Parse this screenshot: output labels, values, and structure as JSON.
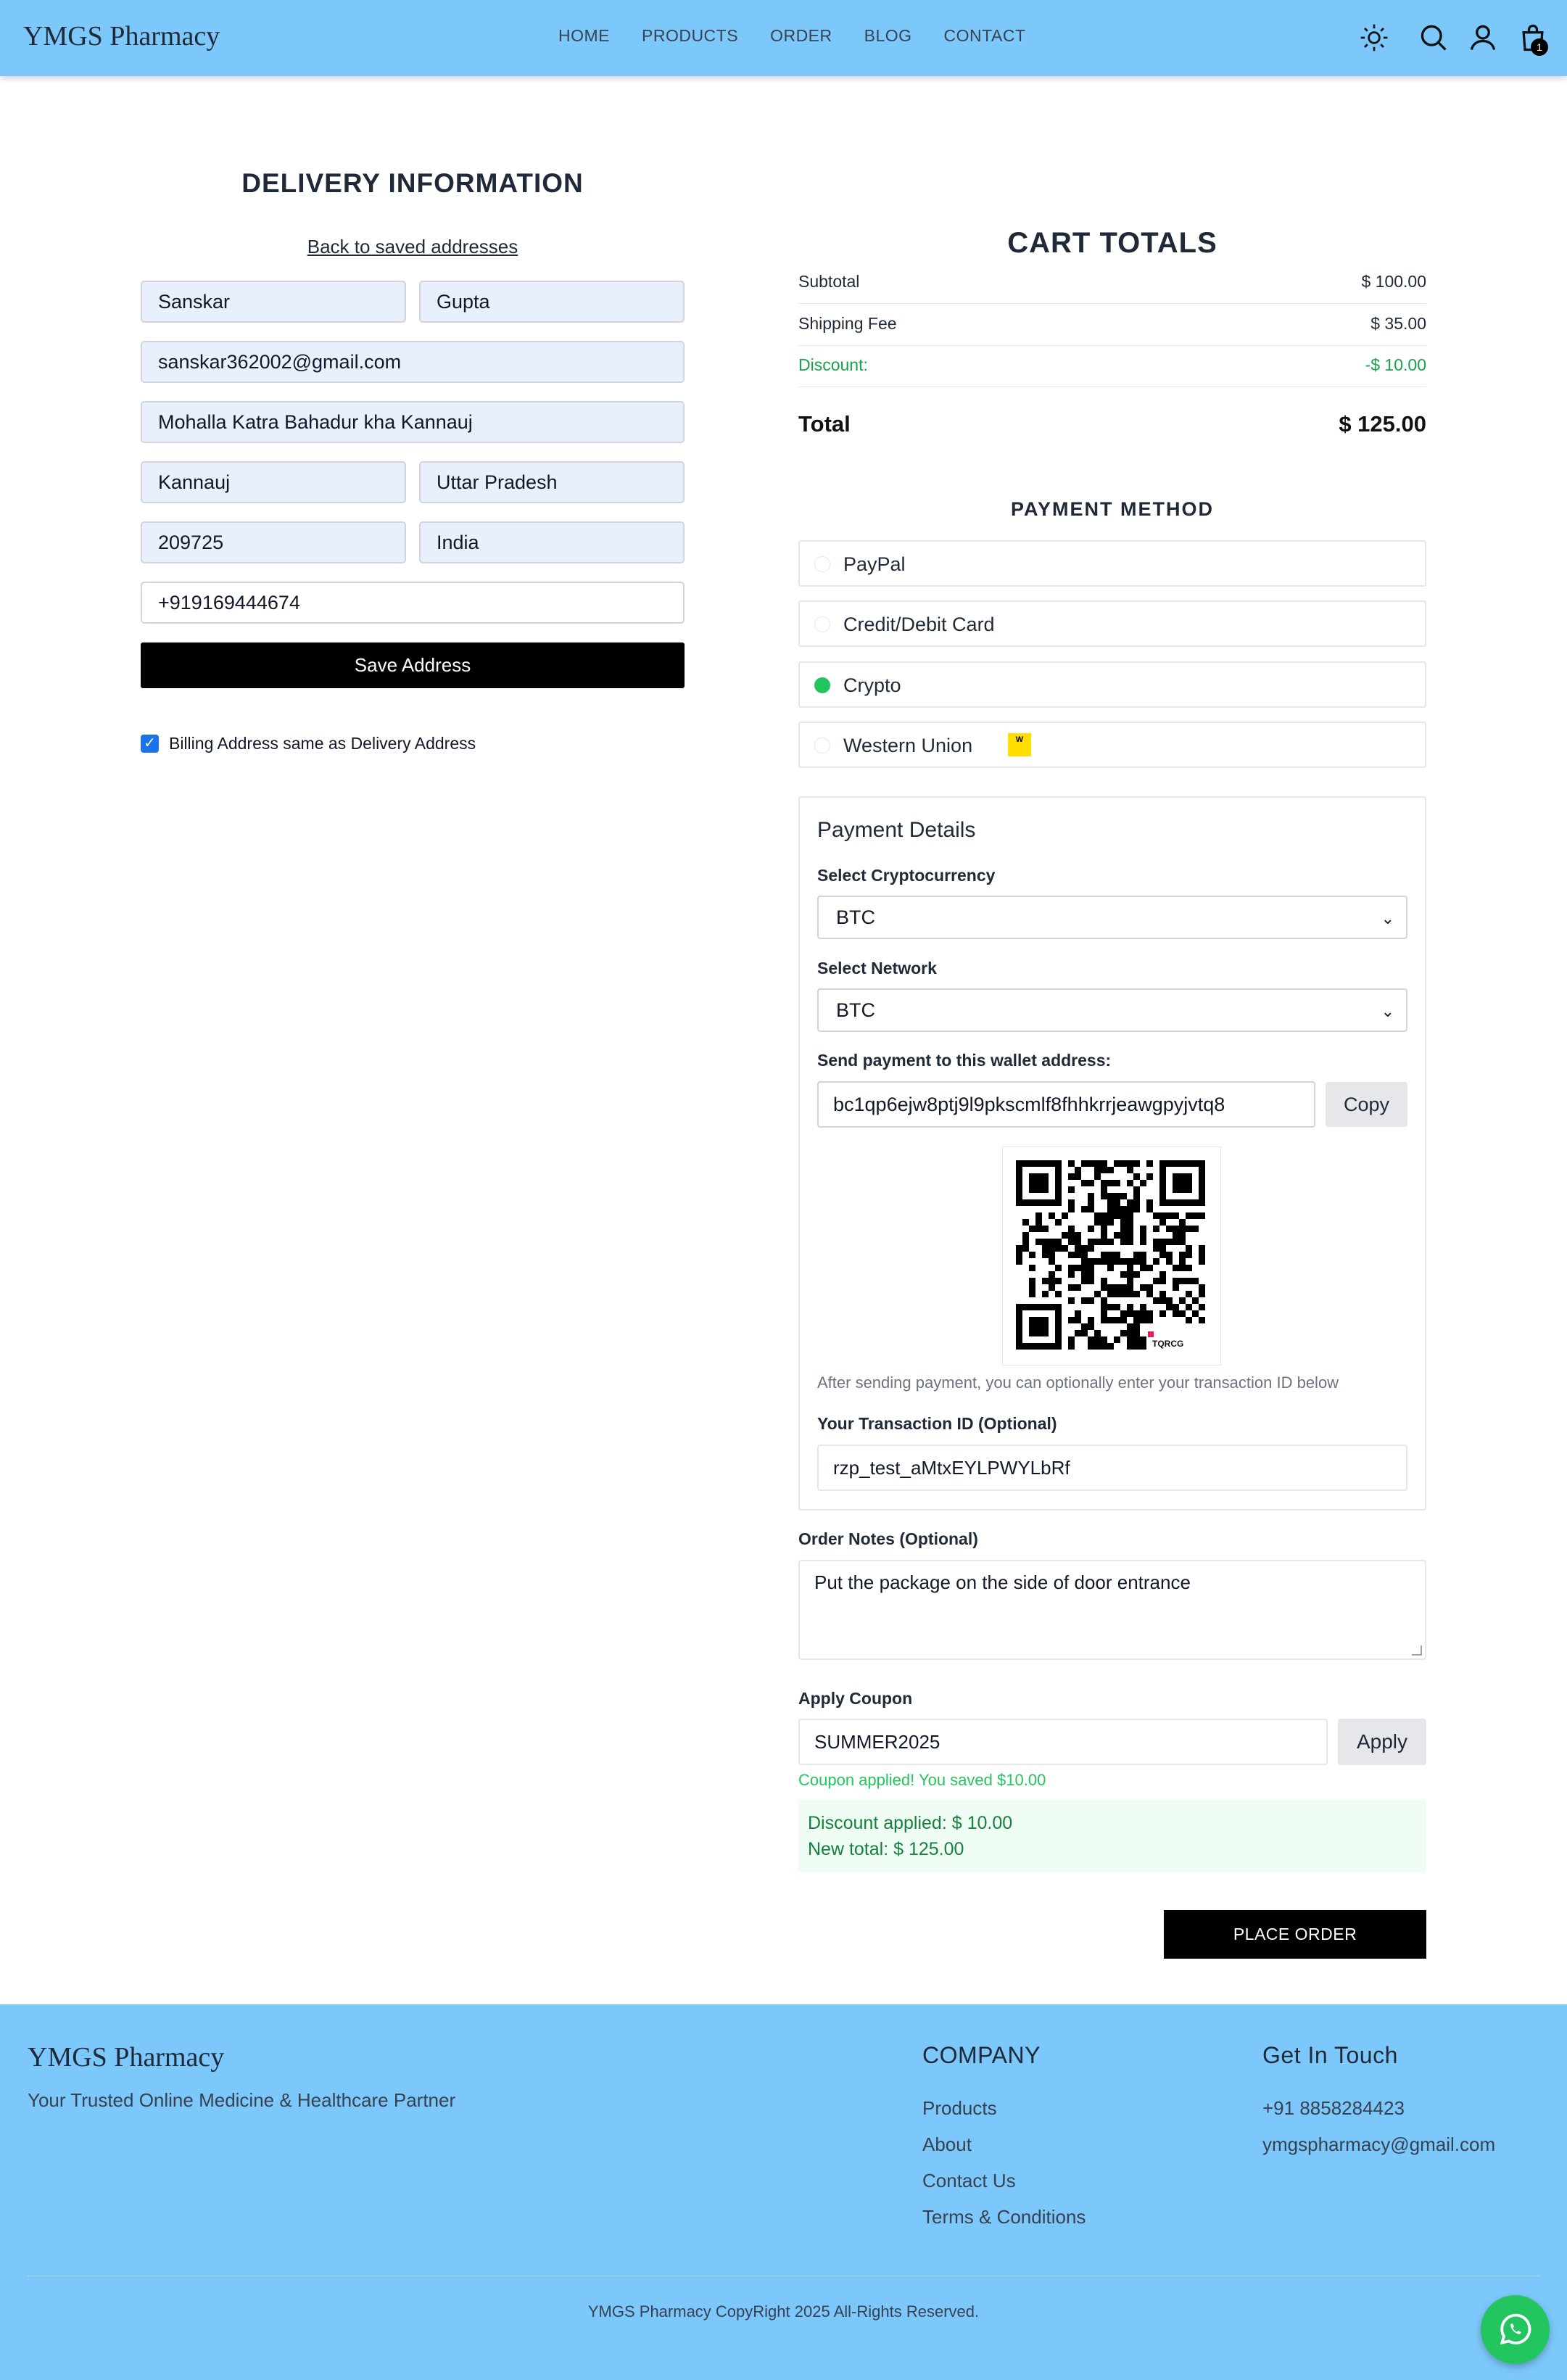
{
  "nav": {
    "brand": "YMGS Pharmacy",
    "links": [
      "HOME",
      "PRODUCTS",
      "ORDER",
      "BLOG",
      "CONTACT"
    ],
    "cart_count": "1",
    "icons": [
      "sun-icon",
      "search-icon",
      "user-icon",
      "shopping-bag-icon"
    ]
  },
  "delivery": {
    "title": "DELIVERY INFORMATION",
    "back_link": "Back to saved addresses",
    "first_name": "Sanskar",
    "last_name": "Gupta",
    "email": "sanskar362002@gmail.com",
    "street": "Mohalla Katra Bahadur kha Kannauj",
    "city": "Kannauj",
    "state": "Uttar Pradesh",
    "zip": "209725",
    "country": "India",
    "phone": "+919169444674",
    "save_button": "Save Address",
    "billing_same_label": "Billing Address same as Delivery Address",
    "billing_same_checked": true
  },
  "cart": {
    "title": "CART TOTALS",
    "subtotal_label": "Subtotal",
    "subtotal": "$ 100.00",
    "shipping_label": "Shipping Fee",
    "shipping": "$ 35.00",
    "discount_label": "Discount:",
    "discount": "-$ 10.00",
    "total_label": "Total",
    "total": "$ 125.00"
  },
  "payment": {
    "title": "PAYMENT  METHOD",
    "options": [
      {
        "label": "PayPal",
        "selected": false
      },
      {
        "label": "Credit/Debit Card",
        "selected": false
      },
      {
        "label": "Crypto",
        "selected": true
      },
      {
        "label": "Western Union",
        "selected": false
      }
    ],
    "western_union_logo_text": "W"
  },
  "payment_details": {
    "title": "Payment Details",
    "crypto_label": "Select Cryptocurrency",
    "crypto_value": "BTC",
    "network_label": "Select Network",
    "network_value": "BTC",
    "wallet_label": "Send payment to this wallet address:",
    "wallet_address": "bc1qp6ejw8ptj9l9pkscmlf8fhhkrrjeawgpyjvtq8",
    "copy_button": "Copy",
    "qr_caption": "TQRCG",
    "after_note": "After sending payment, you can optionally enter your transaction ID below",
    "tx_label": "Your Transaction ID (Optional)",
    "tx_value": "rzp_test_aMtxEYLPWYLbRf"
  },
  "notes": {
    "label": "Order Notes (Optional)",
    "value": "Put the package on the side of door entrance"
  },
  "coupon": {
    "label": "Apply Coupon",
    "value": "SUMMER2025",
    "apply_button": "Apply",
    "success": "Coupon applied! You saved $10.00",
    "discount_applied": "Discount applied: $ 10.00",
    "new_total": "New total: $ 125.00"
  },
  "place_order": "PLACE ORDER",
  "footer": {
    "brand": "YMGS Pharmacy",
    "tagline": "Your Trusted Online Medicine & Healthcare Partner",
    "company_heading": "COMPANY",
    "company_links": [
      "Products",
      "About",
      "Contact Us",
      "Terms & Conditions"
    ],
    "contact_heading": "Get In Touch",
    "phone": "+91 8858284423",
    "email": "ymgspharmacy@gmail.com",
    "copyright": "YMGS Pharmacy CopyRight 2025 All-Rights Reserved."
  },
  "colors": {
    "header_bg": "#7cc8fb",
    "field_bg": "#e8f0fe",
    "accent_green": "#22c55e",
    "discount_green": "#16a34a"
  }
}
